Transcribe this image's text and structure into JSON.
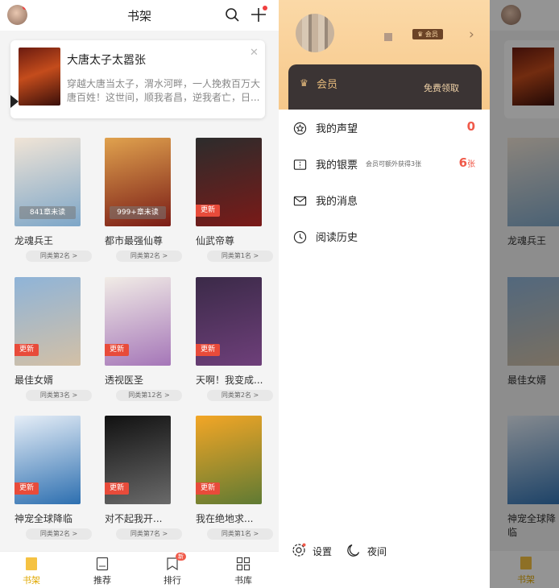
{
  "shelf": {
    "header": {
      "title": "书架"
    },
    "recommend": {
      "title": "大唐太子太嚣张",
      "desc": "穿越大唐当太子，渭水河畔，一人挽救百万大唐百姓！这世间，顺我者昌，逆我者亡，日..."
    },
    "books": [
      {
        "title": "龙魂兵王",
        "rank": "同类第2名 >",
        "pill": "841章未读",
        "update": "",
        "c1": "#f0e4d6",
        "c2": "#7da6c8"
      },
      {
        "title": "都市最强仙尊",
        "rank": "同类第2名 >",
        "pill": "999+章未读",
        "update": "",
        "c1": "#e0a24e",
        "c2": "#7a1c16"
      },
      {
        "title": "仙武帝尊",
        "rank": "同类第1名 >",
        "pill": "",
        "update": "更新",
        "c1": "#2c2c2c",
        "c2": "#7a1a18"
      },
      {
        "title": "最佳女婿",
        "rank": "同类第3名 >",
        "pill": "",
        "update": "更新",
        "c1": "#8fb4d8",
        "c2": "#d3c0a6"
      },
      {
        "title": "透视医圣",
        "rank": "同类第12名 >",
        "pill": "",
        "update": "更新",
        "c1": "#f1ece6",
        "c2": "#a576b8"
      },
      {
        "title": "天啊！我变成...",
        "rank": "同类第2名 >",
        "pill": "",
        "update": "更新",
        "c1": "#3b2a48",
        "c2": "#6e3f7a"
      },
      {
        "title": "神宠全球降临",
        "rank": "同类第2名 >",
        "pill": "",
        "update": "更新",
        "c1": "#e6eef7",
        "c2": "#2d6fb0"
      },
      {
        "title": "对不起我开...",
        "rank": "同类第7名 >",
        "pill": "",
        "update": "更新",
        "c1": "#111111",
        "c2": "#6a6a6a"
      },
      {
        "title": "我在绝地求...",
        "rank": "同类第1名 >",
        "pill": "",
        "update": "更新",
        "c1": "#f3a626",
        "c2": "#5f7a33"
      }
    ],
    "tabs": [
      {
        "label": "书架"
      },
      {
        "label": "推荐"
      },
      {
        "label": "排行"
      },
      {
        "label": "书库"
      }
    ],
    "rank_badge": "新"
  },
  "drawer": {
    "member_badge": "会员",
    "vip": {
      "label": "会员",
      "action": "免费领取"
    },
    "menu": [
      {
        "label": "我的声望",
        "note": "",
        "value": "0",
        "unit": ""
      },
      {
        "label": "我的银票",
        "note": "会员可额外获得3张",
        "value": "6",
        "unit": "张"
      },
      {
        "label": "我的消息",
        "note": "",
        "value": "",
        "unit": ""
      },
      {
        "label": "阅读历史",
        "note": "",
        "value": "",
        "unit": ""
      }
    ],
    "settings_label": "设置",
    "night_label": "夜间"
  },
  "colors": {
    "accent": "#f5c242",
    "red": "#f05a4a",
    "vip_dark": "#3b3434"
  }
}
